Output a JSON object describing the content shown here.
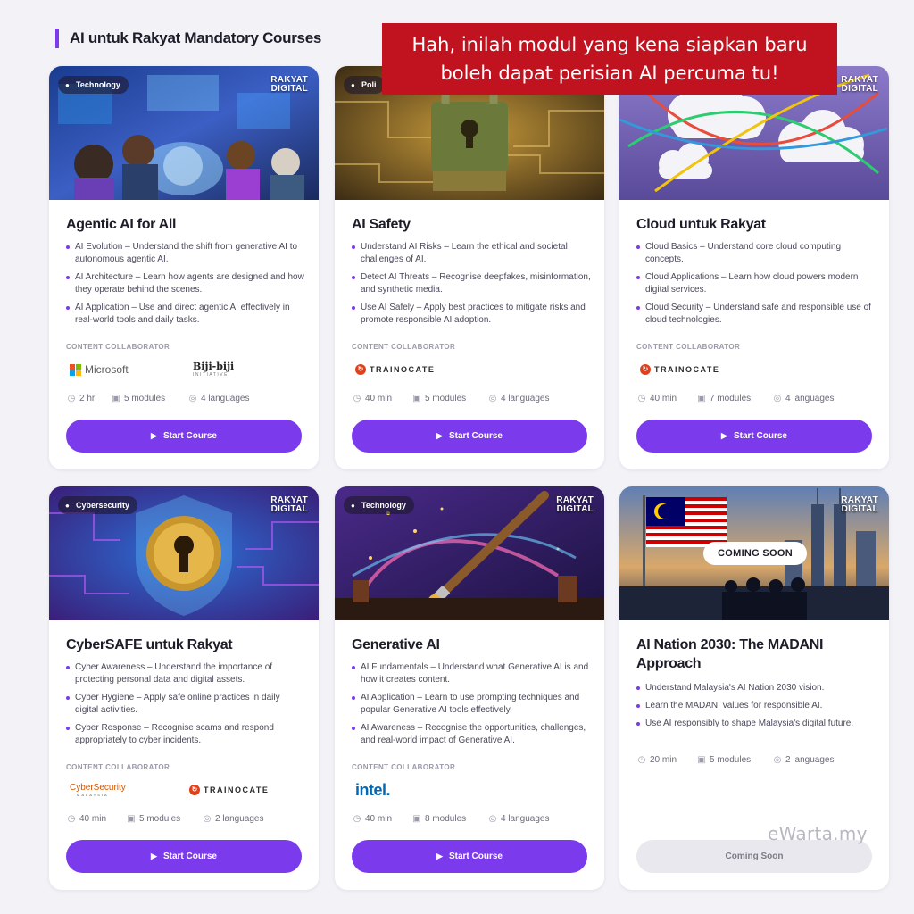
{
  "section": {
    "title": "AI untuk Rakyat Mandatory Courses"
  },
  "banner": {
    "lines": [
      "Hah, inilah modul yang kena siapkan baru",
      "boleh dapat perisian AI percuma tu!"
    ]
  },
  "watermark": "eWarta.my",
  "collab_label": "CONTENT COLLABORATOR",
  "brand_lines": [
    "RAKYAT",
    "DIGITAL"
  ],
  "colors": {
    "accent": "#7c3aed",
    "banner": "#c1121f",
    "disabled_button": "#e8e8ee"
  },
  "cards": [
    {
      "tag": "Technology",
      "tag_icon": "people-icon",
      "title": "Agentic AI for All",
      "bullets": [
        "AI Evolution – Understand the shift from generative AI to autonomous agentic AI.",
        "AI Architecture – Learn how agents are designed and how they operate behind the scenes.",
        "AI Application – Use and direct agentic AI effectively in real-world tools and daily tasks."
      ],
      "collaborators": [
        "Microsoft",
        "Biji-biji",
        "INITIATIVE"
      ],
      "duration": "2 hr",
      "modules": "5 modules",
      "languages": "4 languages",
      "button": "Start Course"
    },
    {
      "tag": "Poli",
      "tag_icon": "people-icon",
      "title": "AI Safety",
      "bullets": [
        "Understand AI Risks – Learn the ethical and societal challenges of AI.",
        "Detect AI Threats – Recognise deepfakes, misinformation, and synthetic media.",
        "Use AI Safely – Apply best practices to mitigate risks and promote responsible AI adoption."
      ],
      "collaborators": [
        "TRAINOCATE"
      ],
      "duration": "40 min",
      "modules": "5 modules",
      "languages": "4 languages",
      "button": "Start Course"
    },
    {
      "tag": "",
      "tag_icon": "",
      "title": "Cloud untuk Rakyat",
      "bullets": [
        "Cloud Basics – Understand core cloud computing concepts.",
        "Cloud Applications – Learn how cloud powers modern digital services.",
        "Cloud Security – Understand safe and responsible use of cloud technologies."
      ],
      "collaborators": [
        "TRAINOCATE"
      ],
      "duration": "40 min",
      "modules": "7 modules",
      "languages": "4 languages",
      "button": "Start Course"
    },
    {
      "tag": "Cybersecurity",
      "tag_icon": "people-icon",
      "title": "CyberSAFE untuk Rakyat",
      "bullets": [
        "Cyber Awareness – Understand the importance of protecting personal data and digital assets.",
        "Cyber Hygiene – Apply safe online practices in daily digital activities.",
        "Cyber Response – Recognise scams and respond appropriately to cyber incidents."
      ],
      "collaborators": [
        "CyberSecurity",
        "MALAYSIA",
        "TRAINOCATE"
      ],
      "duration": "40 min",
      "modules": "5 modules",
      "languages": "2 languages",
      "button": "Start Course"
    },
    {
      "tag": "Technology",
      "tag_icon": "people-icon",
      "title": "Generative AI",
      "bullets": [
        "AI Fundamentals – Understand what Generative AI is and how it creates content.",
        "AI Application – Learn to use prompting techniques and popular Generative AI tools effectively.",
        "AI Awareness – Recognise the opportunities, challenges, and real-world impact of Generative AI."
      ],
      "collaborators": [
        "intel."
      ],
      "duration": "40 min",
      "modules": "8 modules",
      "languages": "4 languages",
      "button": "Start Course"
    },
    {
      "tag": "",
      "tag_icon": "",
      "status": "COMING SOON",
      "title": "AI Nation 2030: The MADANI Approach",
      "bullets": [
        "Understand Malaysia's AI Nation 2030 vision.",
        "Learn the MADANI values for responsible AI.",
        "Use AI responsibly to shape Malaysia's digital future."
      ],
      "collaborators": [],
      "duration": "20 min",
      "modules": "5 modules",
      "languages": "2 languages",
      "button": "Coming Soon"
    }
  ]
}
